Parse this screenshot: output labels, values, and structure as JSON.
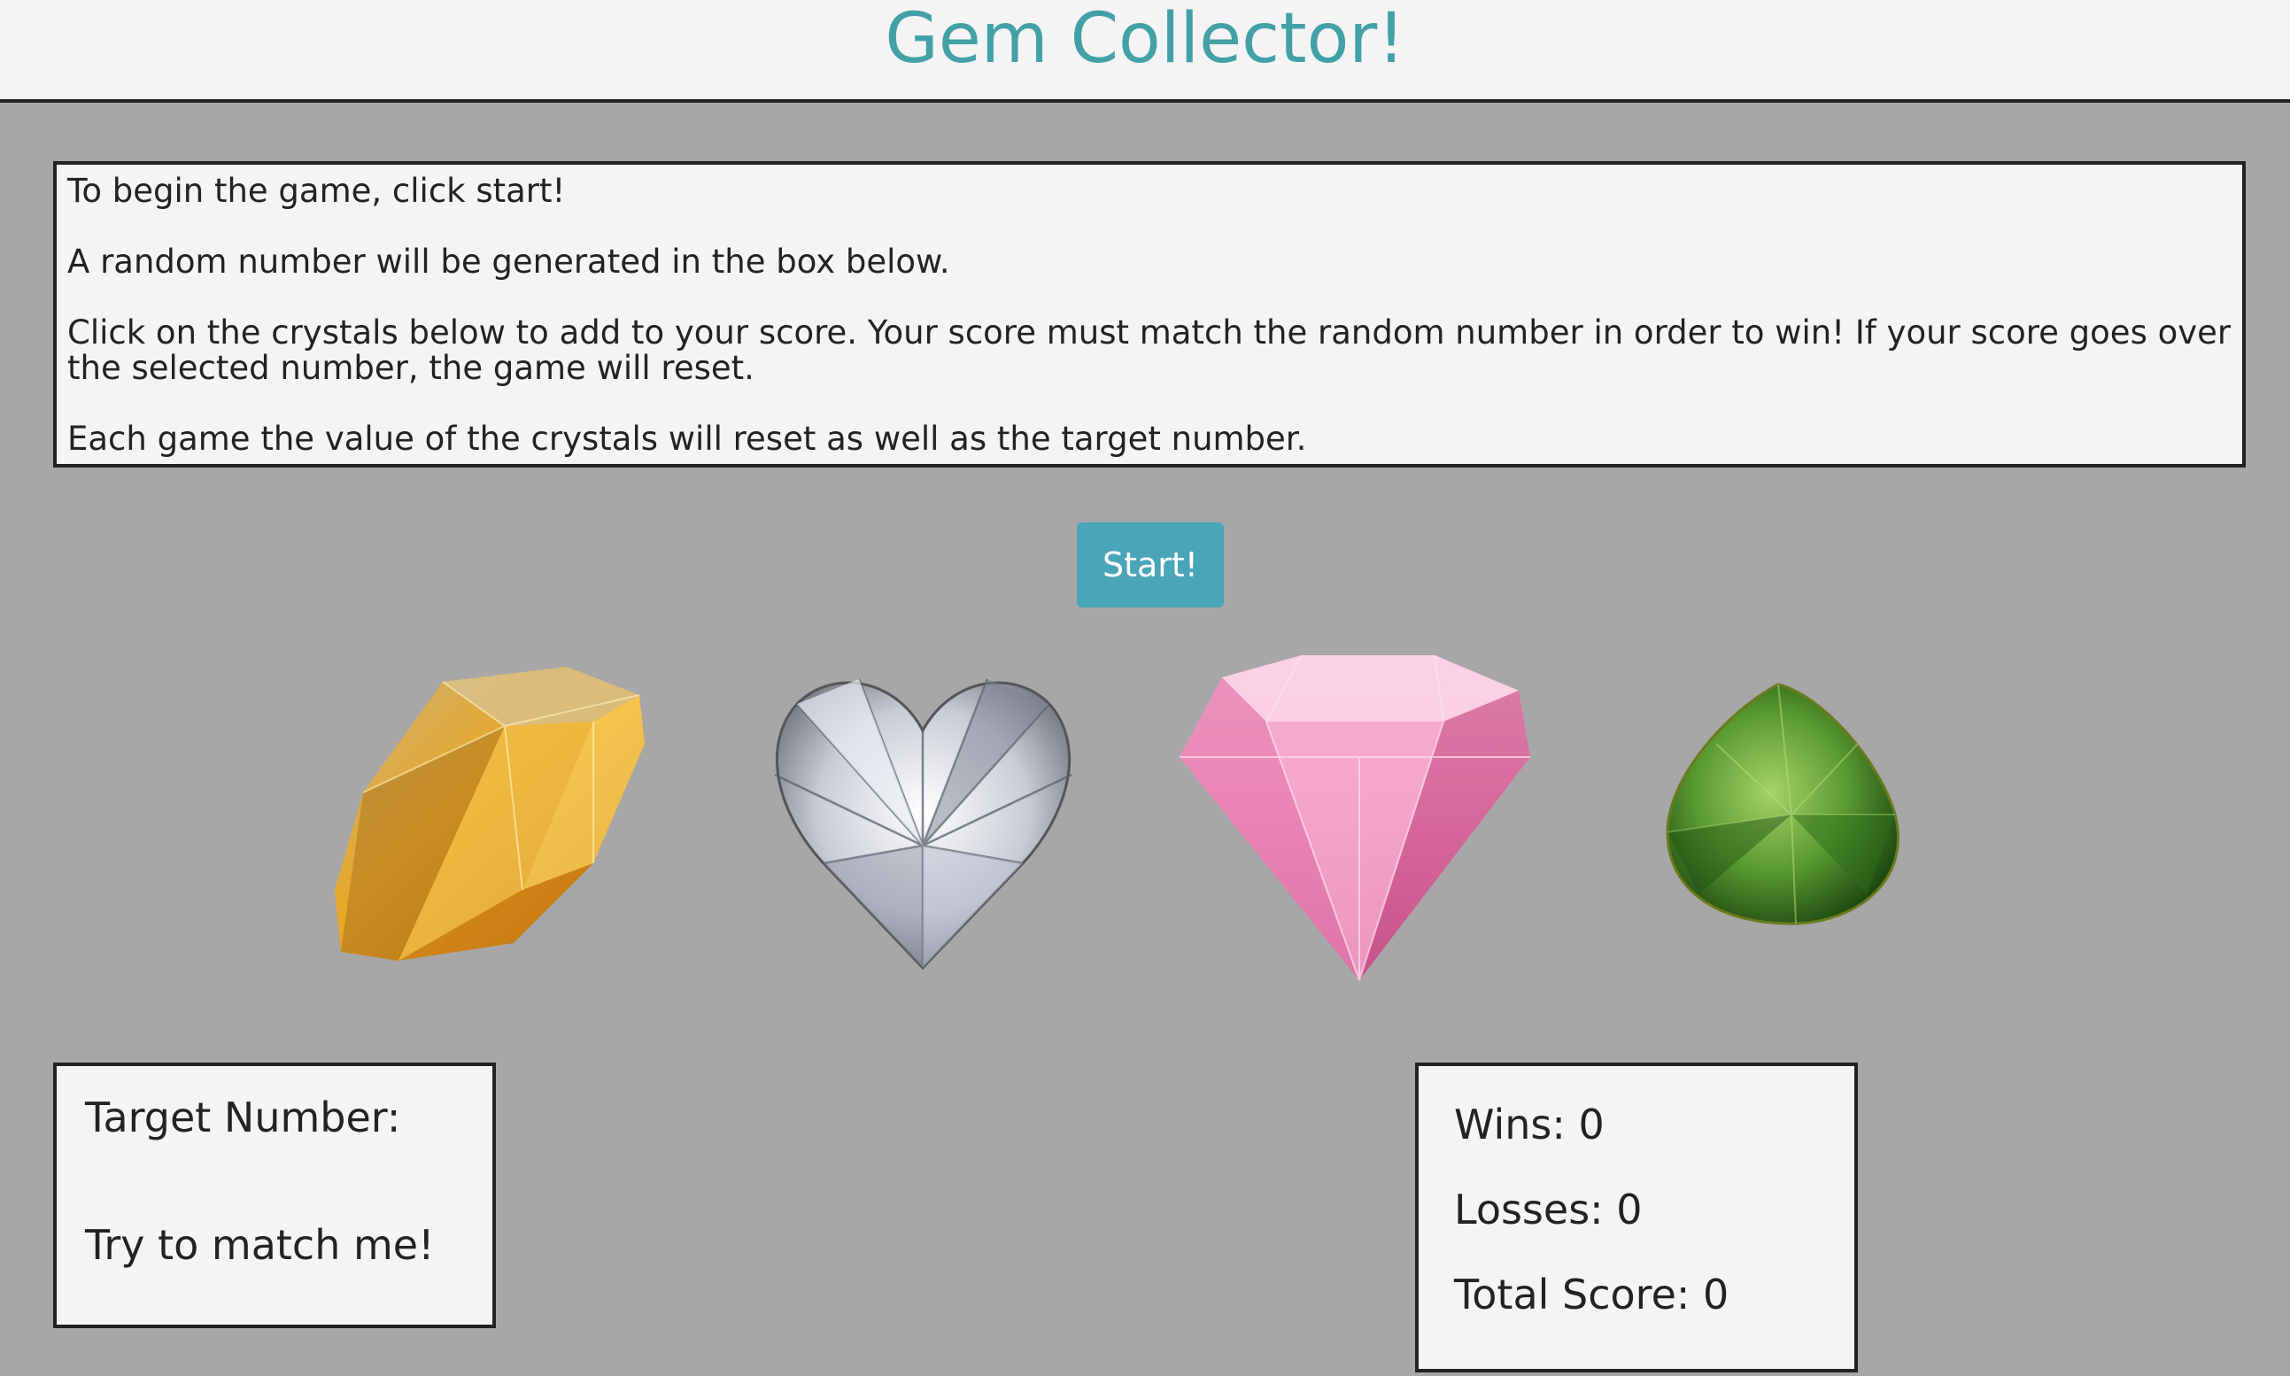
{
  "header": {
    "title": "Gem Collector!"
  },
  "instructions": {
    "paragraphs": [
      "To begin the game, click start!",
      "A random number will be generated in the box below.",
      "Click on the crystals below to add to your score. Your score must match the random number in order to win! If your score goes over the selected number, the game will reset.",
      "Each game the value of the crystals will reset as well as the target number."
    ]
  },
  "start_button": {
    "label": "Start!"
  },
  "gems": [
    {
      "name": "yellow-gem",
      "icon": "yellow-diamond-icon",
      "color": "#e8a825"
    },
    {
      "name": "clear-heart-gem",
      "icon": "clear-heart-diamond-icon",
      "color": "#e2e4ea"
    },
    {
      "name": "pink-gem",
      "icon": "pink-diamond-icon",
      "color": "#f2a3c8"
    },
    {
      "name": "green-gem",
      "icon": "green-pear-gem-icon",
      "color": "#5a9a30"
    }
  ],
  "target": {
    "label": "Target Number:",
    "value": "",
    "hint": "Try to match me!"
  },
  "stats": {
    "wins_label": "Wins:",
    "wins": "0",
    "losses_label": "Losses:",
    "losses": "0",
    "total_label": "Total Score:",
    "total": "0"
  },
  "colors": {
    "background": "#a7a7a7",
    "panel": "#f4f4f4",
    "title": "#43a1a6",
    "button": "#4aa5b9"
  }
}
